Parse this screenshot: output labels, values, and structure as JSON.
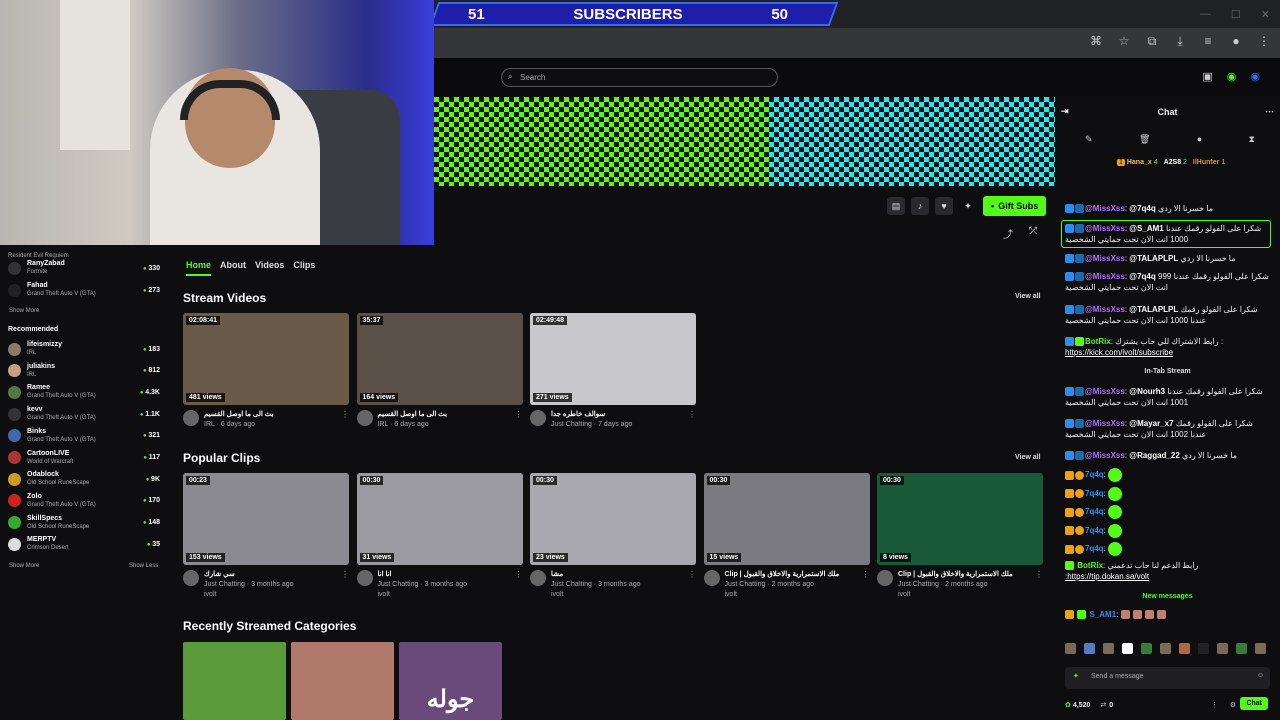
{
  "banner": {
    "left_count": "51",
    "title": "SUBSCRIBERS",
    "right_count": "50"
  },
  "search": {
    "placeholder": "Search"
  },
  "actions": {
    "gift_label": "Gift Subs"
  },
  "sidebar": {
    "top_items": [
      {
        "game": "Resident Evil Requiem"
      },
      {
        "name": "RanyZabad",
        "game": "Fortnite",
        "count": "330"
      },
      {
        "name": "Fahad",
        "game": "Grand Theft Auto V (GTA)",
        "count": "273"
      }
    ],
    "show_more_1": "Show More",
    "recommended_heading": "Recommended",
    "recommended": [
      {
        "name": "lifeismizzy",
        "game": "IRL",
        "count": "183",
        "color": "#8a7a6a"
      },
      {
        "name": "juliakins",
        "game": "IRL",
        "count": "812",
        "color": "#c8a080"
      },
      {
        "name": "Ramee",
        "game": "Grand Theft Auto V (GTA)",
        "count": "4.3K",
        "color": "#557744"
      },
      {
        "name": "kevv",
        "game": "Grand Theft Auto V (GTA)",
        "count": "1.1K",
        "color": "#333333"
      },
      {
        "name": "Binks",
        "game": "Grand Theft Auto V (GTA)",
        "count": "321",
        "color": "#4466aa"
      },
      {
        "name": "CartoonLIVE",
        "game": "World of Warcraft",
        "count": "117",
        "color": "#aa3333"
      },
      {
        "name": "Odablock",
        "game": "Old School RuneScape",
        "count": "9K",
        "color": "#cc9922"
      },
      {
        "name": "Zolo",
        "game": "Grand Theft Auto V (GTA)",
        "count": "170",
        "color": "#cc2222"
      },
      {
        "name": "SkillSpecs",
        "game": "Old School RuneScape",
        "count": "148",
        "color": "#33aa33"
      },
      {
        "name": "MERPTV",
        "game": "Crimson Desert",
        "count": "35",
        "color": "#dddddd"
      }
    ],
    "show_more_2": "Show More",
    "show_less": "Show Less"
  },
  "tabs": [
    "Home",
    "About",
    "Videos",
    "Clips"
  ],
  "stream_videos": {
    "title": "Stream Videos",
    "view_all": "View all",
    "items": [
      {
        "duration": "02:08:41",
        "views": "481 views",
        "title": "بث الى ما اوصل القسيم",
        "category": "IRL",
        "age": "6 days ago",
        "bg": "#6a5a4a"
      },
      {
        "duration": "35:37",
        "views": "164 views",
        "title": "بث الى ما اوصل القسيم",
        "category": "IRL",
        "age": "6 days ago",
        "bg": "#5a5048"
      },
      {
        "duration": "02:49:48",
        "views": "271 views",
        "title": "سوالف خاطره جدا",
        "category": "Just Chatting",
        "age": "7 days ago",
        "bg": "#c8c8cc"
      }
    ]
  },
  "popular_clips": {
    "title": "Popular Clips",
    "view_all": "View all",
    "items": [
      {
        "duration": "00:23",
        "views": "153 views",
        "title": "سي شارك",
        "category": "Just Chatting",
        "age": "3 months ago",
        "channel": "ivolt",
        "bg": "#8a8a90"
      },
      {
        "duration": "00:30",
        "views": "31 views",
        "title": "انا انا",
        "category": "Just Chatting",
        "age": "3 months ago",
        "channel": "ivolt",
        "bg": "#9a9aa0"
      },
      {
        "duration": "00:30",
        "views": "23 views",
        "title": "مشا",
        "category": "Just Chatting",
        "age": "3 months ago",
        "channel": "ivolt",
        "bg": "#a8a8ae"
      },
      {
        "duration": "00:30",
        "views": "15 views",
        "title": "Clip | ملك الاستمرارية والاخلاق والقبول",
        "category": "Just Chatting",
        "age": "2 months ago",
        "channel": "ivolt",
        "bg": "#7a7a80"
      },
      {
        "duration": "00:30",
        "views": "8 views",
        "title": "Clip | ملك الاستمرارية والاخلاق والقبول",
        "category": "Just Chatting",
        "age": "2 months ago",
        "channel": "ivolt",
        "bg": "#1a5a3a"
      }
    ]
  },
  "recent_categories": {
    "title": "Recently Streamed Categories",
    "items": [
      {
        "label": "",
        "bg": "#5a9a3a"
      },
      {
        "label": "",
        "bg": "#b07a6a"
      },
      {
        "label": "جوله",
        "bg": "#6a4a7a"
      }
    ]
  },
  "chat": {
    "title": "Chat",
    "pinned": {
      "u1": "Hana_x",
      "u1_count": "4",
      "u2": "A2S8",
      "u2_count": "2",
      "u3": "IlHunter",
      "u3_count": "1"
    },
    "messages": [
      {
        "user": "@MissXss",
        "mention": "@7q4q",
        "text": "ما خسرنا الا ردي",
        "color": "#b070ff"
      },
      {
        "user": "@MissXss",
        "mention": "@S_AM1",
        "text": "شكرا على الفولو رقمك عندنا 1000 انت الان تحت حمايتي الشخصية",
        "color": "#b070ff",
        "highlight": true
      },
      {
        "user": "@MissXss",
        "mention": "@TALAPLPL",
        "text": "ما خسرنا الا ردي",
        "color": "#b070ff"
      },
      {
        "user": "@MissXss",
        "mention": "@7q4q",
        "text": "شكرا على الفولو رقمك عندنا 999 انت الان تحت حمايتي الشخصية",
        "color": "#b070ff"
      },
      {
        "user": "@MissXss",
        "mention": "@TALAPLPL",
        "text": "شكرا على الفولو رقمك عندنا 1000 انت الان تحت حمايتي الشخصية",
        "color": "#b070ff"
      },
      {
        "user": "BotRix",
        "mention": "",
        "text": "رابط الاشتراك للي حاب يشترك :",
        "link": "https://kick.com/ivolt/subscribe",
        "color": "#53fc18"
      }
    ],
    "in_tab": "In-Tab Stream",
    "messages2": [
      {
        "user": "@MissXss",
        "mention": "@Nourh3",
        "text": "شكرا على الفولو رقمك عندنا 1001 انت الان تحت حمايتي الشخصية",
        "color": "#b070ff"
      },
      {
        "user": "@MissXss",
        "mention": "@Mayar_x7",
        "text": "شكرا على الفولو رقمك عندنا 1002 انت الان تحت حمايتي الشخصية",
        "color": "#b070ff"
      },
      {
        "user": "@MissXss",
        "mention": "@Raggad_22",
        "text": "ما خسرنا الا ردي",
        "color": "#b070ff"
      }
    ],
    "repeat_user": "7q4q",
    "botrix2": {
      "user": "BotRix",
      "text": "رابط الدعم لنا حاب تدعمني",
      "link": ":https://tip.dokan.sa/volt"
    },
    "new_messages": "New messages",
    "last_user": "S_AM1",
    "input_placeholder": "Send a message",
    "points": "4,520",
    "zero": "0",
    "send_label": "Chat"
  }
}
